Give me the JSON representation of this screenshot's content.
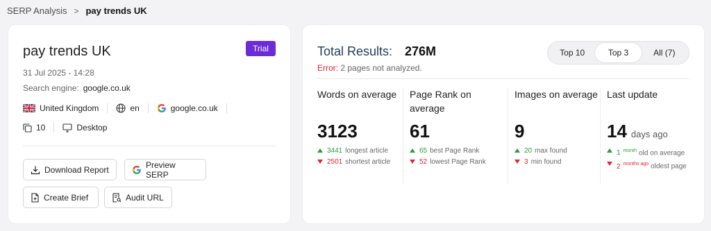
{
  "breadcrumb": {
    "parent": "SERP Analysis",
    "separator": ">",
    "current": "pay trends UK"
  },
  "keyword": {
    "title": "pay trends UK",
    "badge": "Trial",
    "date": "31 Jul 2025 - 14:28",
    "engine_label": "Search engine:",
    "engine_value": "google.co.uk",
    "country": "United Kingdom",
    "language": "en",
    "domain": "google.co.uk",
    "result_count": "10",
    "device": "Desktop"
  },
  "actions": {
    "download": "Download Report",
    "preview": "Preview SERP",
    "brief": "Create Brief",
    "audit": "Audit URL"
  },
  "results": {
    "total_label": "Total Results:",
    "total_value": "276M",
    "error_prefix": "Error:",
    "error_text": " 2 pages not analyzed.",
    "tabs": [
      "Top 10",
      "Top 3",
      "All (7)"
    ],
    "active_tab": "Top 3"
  },
  "stats": {
    "words": {
      "label": "Words on average",
      "value": "3123",
      "up_num": "3441",
      "up_text": "longest article",
      "down_num": "2501",
      "down_text": "shortest article"
    },
    "pagerank": {
      "label": "Page Rank on average",
      "value": "61",
      "up_num": "65",
      "up_text": "best Page Rank",
      "down_num": "52",
      "down_text": "lowest Page Rank"
    },
    "images": {
      "label": "Images on average",
      "value": "9",
      "up_num": "20",
      "up_text": "max found",
      "down_num": "3",
      "down_text": "min found"
    },
    "update": {
      "label": "Last update",
      "value": "14",
      "suffix": "days ago",
      "up_num": "1",
      "up_sup": "month",
      "up_text": "old on average",
      "down_num": "2",
      "down_sup": "months ago",
      "down_text": "oldest page"
    }
  },
  "colors": {
    "accent": "#6c2bd9",
    "error": "#e0242e",
    "up": "#2a9d3b",
    "down": "#e0242e"
  }
}
